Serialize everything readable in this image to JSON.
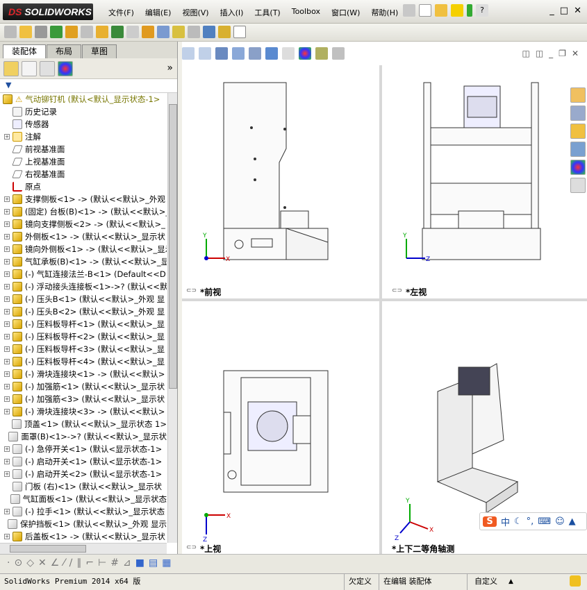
{
  "app": {
    "logo_prefix": "DS",
    "logo_text": "SOLIDWORKS"
  },
  "menu": [
    "文件(F)",
    "编辑(E)",
    "视图(V)",
    "插入(I)",
    "工具(T)",
    "Toolbox",
    "窗口(W)",
    "帮助(H)"
  ],
  "winbtns": [
    "_",
    "□",
    "✕"
  ],
  "tabs": [
    "装配体",
    "布局",
    "草图"
  ],
  "tree": {
    "root": "气动铆钉机 (默认<默认_显示状态-1>",
    "items": [
      {
        "label": "历史记录",
        "kind": "history",
        "exp": false
      },
      {
        "label": "传感器",
        "kind": "sensor",
        "exp": false
      },
      {
        "label": "注解",
        "kind": "annot",
        "exp": true
      },
      {
        "label": "前视基准面",
        "kind": "plane",
        "exp": false
      },
      {
        "label": "上视基准面",
        "kind": "plane",
        "exp": false
      },
      {
        "label": "右视基准面",
        "kind": "plane",
        "exp": false
      },
      {
        "label": "原点",
        "kind": "origin",
        "exp": false
      },
      {
        "label": "支撑侧板<1> -> (默认<<默认>_外观",
        "kind": "part",
        "exp": true
      },
      {
        "label": "(固定) 台板(B)<1> -> (默认<<默认>_",
        "kind": "part",
        "exp": true
      },
      {
        "label": "镜向支撑侧板<2> -> (默认<<默认>_",
        "kind": "part",
        "exp": true
      },
      {
        "label": "外侧板<1> -> (默认<<默认>_显示状",
        "kind": "part",
        "exp": true
      },
      {
        "label": "镜向外侧板<1> -> (默认<<默认>_显示",
        "kind": "part",
        "exp": true
      },
      {
        "label": "气缸承板(B)<1> -> (默认<<默认>_显",
        "kind": "part",
        "exp": true
      },
      {
        "label": "(-) 气缸连接法兰-B<1> (Default<<D",
        "kind": "part",
        "exp": true
      },
      {
        "label": "(-) 浮动接头连接板<1>->? (默认<<默",
        "kind": "part",
        "exp": true
      },
      {
        "label": "(-) 压头B<1> (默认<<默认>_外观 显",
        "kind": "part",
        "exp": true
      },
      {
        "label": "(-) 压头B<2> (默认<<默认>_外观 显",
        "kind": "part",
        "exp": true
      },
      {
        "label": "(-) 压料板导杆<1> (默认<<默认>_显",
        "kind": "part",
        "exp": true
      },
      {
        "label": "(-) 压料板导杆<2> (默认<<默认>_显",
        "kind": "part",
        "exp": true
      },
      {
        "label": "(-) 压料板导杆<3> (默认<<默认>_显",
        "kind": "part",
        "exp": true
      },
      {
        "label": "(-) 压料板导杆<4> (默认<<默认>_显",
        "kind": "part",
        "exp": true
      },
      {
        "label": "(-) 滑块连接块<1> -> (默认<<默认>",
        "kind": "part",
        "exp": true
      },
      {
        "label": "(-) 加强筋<1> (默认<<默认>_显示状",
        "kind": "part",
        "exp": true
      },
      {
        "label": "(-) 加强筋<3> (默认<<默认>_显示状",
        "kind": "part",
        "exp": true
      },
      {
        "label": "(-) 滑块连接块<3> -> (默认<<默认>",
        "kind": "part",
        "exp": true
      },
      {
        "label": "顶盖<1> (默认<<默认>_显示状态 1>",
        "kind": "gray",
        "exp": false
      },
      {
        "label": "面罩(B)<1>->? (默认<<默认>_显示状",
        "kind": "gray",
        "exp": false
      },
      {
        "label": "(-) 急停开关<1> (默认<显示状态-1>",
        "kind": "gray",
        "exp": true
      },
      {
        "label": "(-) 启动开关<1> (默认<显示状态-1>",
        "kind": "gray",
        "exp": true
      },
      {
        "label": "(-) 启动开关<2> (默认<显示状态-1>",
        "kind": "gray",
        "exp": true
      },
      {
        "label": "门板 (右)<1> (默认<<默认>_显示状",
        "kind": "gray",
        "exp": false
      },
      {
        "label": "气缸面板<1> (默认<<默认>_显示状态",
        "kind": "gray",
        "exp": false
      },
      {
        "label": "(-) 拉手<1> (默认<<默认>_显示状态",
        "kind": "gray",
        "exp": true
      },
      {
        "label": "保护挡板<1> (默认<<默认>_外观 显示",
        "kind": "gray",
        "exp": false
      },
      {
        "label": "后盖板<1> -> (默认<<默认>_显示状",
        "kind": "part",
        "exp": true
      }
    ]
  },
  "views": {
    "front": "*前视",
    "left": "*左视",
    "top": "*上视",
    "iso": "*上下二等角轴测"
  },
  "axes": {
    "x": "X",
    "y": "Y",
    "z": "Z"
  },
  "ime": {
    "lang": "中"
  },
  "status": {
    "product": "SolidWorks Premium 2014 x64 版",
    "defined": "欠定义",
    "mode": "在编辑 装配体",
    "units": "自定义"
  }
}
